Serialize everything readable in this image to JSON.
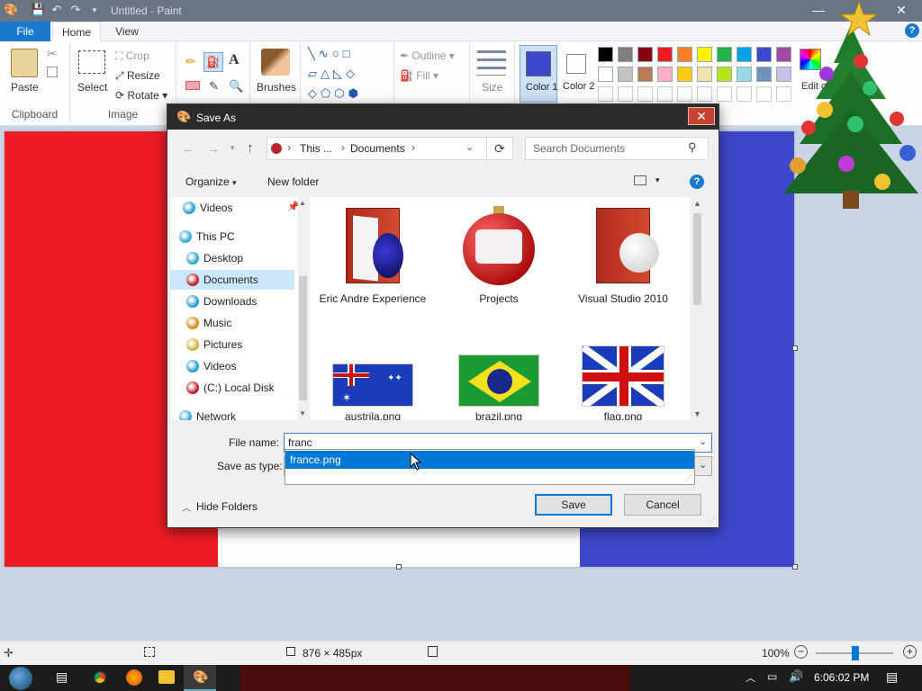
{
  "window": {
    "title": "Untitled - Paint",
    "minimize": "—",
    "maximize": "☐",
    "close": "✕",
    "help": "?"
  },
  "tabs": {
    "file": "File",
    "home": "Home",
    "view": "View"
  },
  "ribbon": {
    "paste": "Paste",
    "clipboard": "Clipboard",
    "select": "Select",
    "crop": "Crop",
    "resize": "Resize",
    "rotate": "Rotate",
    "image": "Image",
    "brushes": "Brushes",
    "outline": "Outline",
    "fill": "Fill",
    "size": "Size",
    "color1": "Color 1",
    "color2": "Color 2",
    "edit_colors": "Edit colors",
    "palette": [
      "#000000",
      "#7f7f7f",
      "#880015",
      "#ed1c24",
      "#ff7f27",
      "#fff200",
      "#22b14c",
      "#00a2e8",
      "#3f48cc",
      "#a349a4",
      "#ffffff",
      "#c3c3c3",
      "#b97a57",
      "#ffaec9",
      "#ffc90e",
      "#efe4b0",
      "#b5e61d",
      "#99d9ea",
      "#7092be",
      "#c8bfe7"
    ],
    "color1_value": "#3f48cc",
    "color2_value": "#ffffff"
  },
  "canvas": {
    "stripes": [
      "#ed1c24",
      "#ffffff",
      "#3f48cc"
    ]
  },
  "dialog": {
    "title": "Save As",
    "breadcrumb": [
      "This ...",
      "Documents"
    ],
    "search_placeholder": "Search Documents",
    "organize": "Organize",
    "new_folder": "New folder",
    "nav": [
      {
        "label": "Videos",
        "color": "#2a9ed8"
      },
      {
        "label": "This PC",
        "color": "#3aa8d8"
      },
      {
        "label": "Desktop",
        "color": "#32a9c9"
      },
      {
        "label": "Documents",
        "color": "#c0242a"
      },
      {
        "label": "Downloads",
        "color": "#2a9ed8"
      },
      {
        "label": "Music",
        "color": "#d8871c"
      },
      {
        "label": "Pictures",
        "color": "#d8b23a"
      },
      {
        "label": "Videos",
        "color": "#2a9ed8"
      },
      {
        "label": "(C:) Local Disk",
        "color": "#c0242a"
      },
      {
        "label": "Network",
        "color": "#3aa8d8"
      }
    ],
    "files": [
      {
        "label": "Eric Andre Experience"
      },
      {
        "label": "Projects"
      },
      {
        "label": "Visual Studio 2010"
      },
      {
        "label": "austrila.png"
      },
      {
        "label": "brazil.png"
      },
      {
        "label": "flag.png"
      }
    ],
    "file_name_label": "File name:",
    "file_name_value": "franc",
    "save_as_type_label": "Save as type:",
    "suggestion": "france.png",
    "hide_folders": "Hide Folders",
    "save": "Save",
    "cancel": "Cancel"
  },
  "status": {
    "dimensions": "876 × 485px",
    "zoom": "100%"
  },
  "taskbar": {
    "time": "6:06:02 PM"
  }
}
